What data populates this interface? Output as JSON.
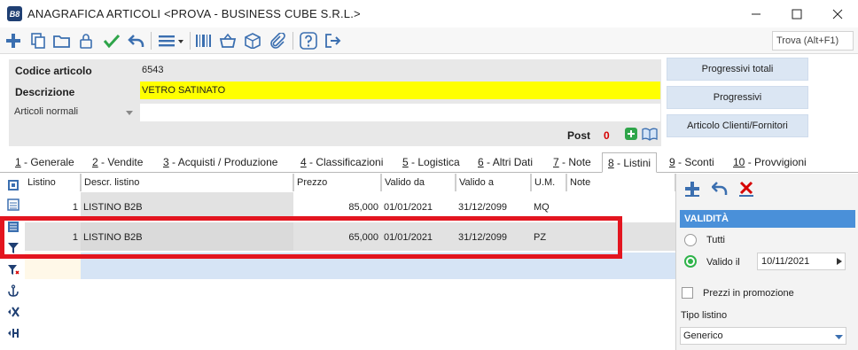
{
  "window": {
    "logo": "B8",
    "title": "ANAGRAFICA ARTICOLI <PROVA - BUSINESS CUBE S.R.L.>"
  },
  "toolbar": {
    "find_label": "Trova (Alt+F1)"
  },
  "header": {
    "code_label": "Codice articolo",
    "code_value": "6543",
    "desc_label": "Descrizione",
    "desc_value": "VETRO SATINATO",
    "type_value": "Articoli normali",
    "post_label": "Post",
    "post_count": "0"
  },
  "side_buttons": {
    "progressivi_totali": "Progressivi totali",
    "progressivi": "Progressivi",
    "clienti_fornitori": "Articolo Clienti/Fornitori"
  },
  "tabs": [
    {
      "num": "1",
      "label": " - Generale"
    },
    {
      "num": "2",
      "label": " - Vendite"
    },
    {
      "num": "3",
      "label": " - Acquisti / Produzione"
    },
    {
      "num": "4",
      "label": " - Classificazioni"
    },
    {
      "num": "5",
      "label": " - Logistica"
    },
    {
      "num": "6",
      "label": " - Altri Dati"
    },
    {
      "num": "7",
      "label": " - Note"
    },
    {
      "num": "8",
      "label": " - Listini"
    },
    {
      "num": "9",
      "label": " - Sconti"
    },
    {
      "num": "10",
      "label": " - Provvigioni"
    }
  ],
  "grid": {
    "columns": [
      "Listino",
      "Descr. listino",
      "Prezzo",
      "Valido da",
      "Valido a",
      "U.M.",
      "Note"
    ],
    "rows": [
      {
        "listino": "1",
        "descr": "LISTINO B2B",
        "prezzo": "85,000",
        "da": "01/01/2021",
        "a": "31/12/2099",
        "um": "MQ",
        "note": ""
      },
      {
        "listino": "1",
        "descr": "LISTINO B2B",
        "prezzo": "65,000",
        "da": "01/01/2021",
        "a": "31/12/2099",
        "um": "PZ",
        "note": ""
      }
    ]
  },
  "validity": {
    "header": "VALIDITÀ",
    "all_label": "Tutti",
    "valid_label": "Valido il",
    "valid_date": "10/11/2021",
    "promo_label": "Prezzi in promozione",
    "type_label": "Tipo listino",
    "type_value": "Generico"
  },
  "colors": {
    "accent": "#4a90d9",
    "highlight": "#e3151f",
    "desc_bg": "#ffff00",
    "post_count": "#d60000"
  }
}
